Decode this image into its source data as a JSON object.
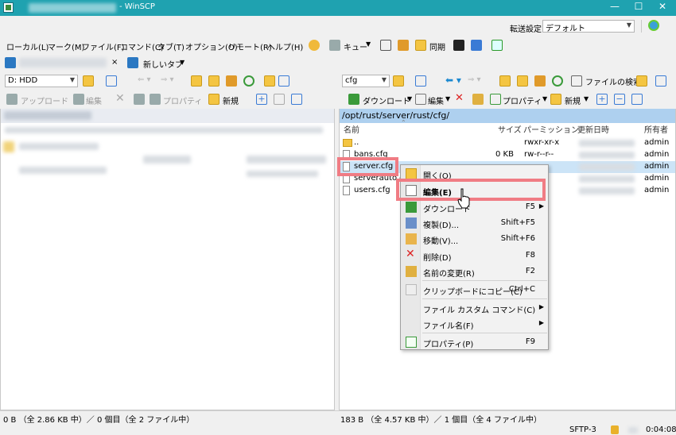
{
  "window": {
    "title": "- WinSCP"
  },
  "transfer": {
    "label": "転送設定",
    "value": "デフォルト"
  },
  "menu": [
    "ローカル(L)",
    "マーク(M)",
    "ファイル(F)",
    "コマンド(C)",
    "タブ(T)",
    "オプション(O)",
    "リモート(R)",
    "ヘルプ(H)"
  ],
  "toolbar": {
    "queue_label": "キュー",
    "sync_label": "同期"
  },
  "tabs": {
    "new_tab": "新しいタブ",
    "close": "×"
  },
  "left": {
    "drive": "D: HDD",
    "upload_label": "アップロード",
    "edit_label": "編集",
    "properties_label": "プロパティ",
    "new_label": "新規"
  },
  "right": {
    "folder": "cfg",
    "search_label": "ファイルの検索",
    "download_label": "ダウンロード",
    "edit_label": "編集",
    "properties_label": "プロパティ",
    "new_label": "新規",
    "path": "/opt/rust/server/rust/cfg/",
    "columns": {
      "name": "名前",
      "size": "サイズ",
      "perm": "パーミッション",
      "date": "更新日時",
      "owner": "所有者"
    },
    "files": [
      {
        "name": "..",
        "size": "",
        "perm": "rwxr-xr-x",
        "owner": "admin"
      },
      {
        "name": "bans.cfg",
        "size": "0 KB",
        "perm": "rw-r--r--",
        "owner": "admin"
      },
      {
        "name": "server.cfg",
        "size": "",
        "perm": "",
        "owner": "admin"
      },
      {
        "name": "serverauto.c",
        "size": "",
        "perm": "",
        "owner": "admin"
      },
      {
        "name": "users.cfg",
        "size": "",
        "perm": "",
        "owner": "admin"
      }
    ]
  },
  "context_menu": {
    "items": [
      {
        "label": "開く(O)",
        "shortcut": "",
        "submenu": false
      },
      {
        "label": "編集(E)",
        "shortcut": "",
        "submenu": false
      },
      {
        "label": "ダウンロード",
        "shortcut": "F5",
        "submenu": true
      },
      {
        "label": "複製(D)...",
        "shortcut": "Shift+F5",
        "submenu": false
      },
      {
        "label": "移動(V)...",
        "shortcut": "Shift+F6",
        "submenu": false
      },
      {
        "label": "削除(D)",
        "shortcut": "F8",
        "submenu": false
      },
      {
        "label": "名前の変更(R)",
        "shortcut": "F2",
        "submenu": false
      },
      {
        "label": "クリップボードにコピー(C)",
        "shortcut": "Ctrl+C",
        "submenu": false
      },
      {
        "label": "ファイル カスタム コマンド(C)",
        "shortcut": "",
        "submenu": true
      },
      {
        "label": "ファイル名(F)",
        "shortcut": "",
        "submenu": true
      },
      {
        "label": "プロパティ(P)",
        "shortcut": "F9",
        "submenu": false
      }
    ]
  },
  "status": {
    "left": "0 B （全 2.86 KB 中）／ 0 個目（全 2 ファイル中）",
    "right": "183 B （全 4.57 KB 中）／ 1 個目（全 4 ファイル中）",
    "protocol": "SFTP-3",
    "time": "0:04:08"
  },
  "colors": {
    "titlebar": "#1fa2b0",
    "highlight": "#f07c84",
    "path_bar": "#aed0ef"
  }
}
